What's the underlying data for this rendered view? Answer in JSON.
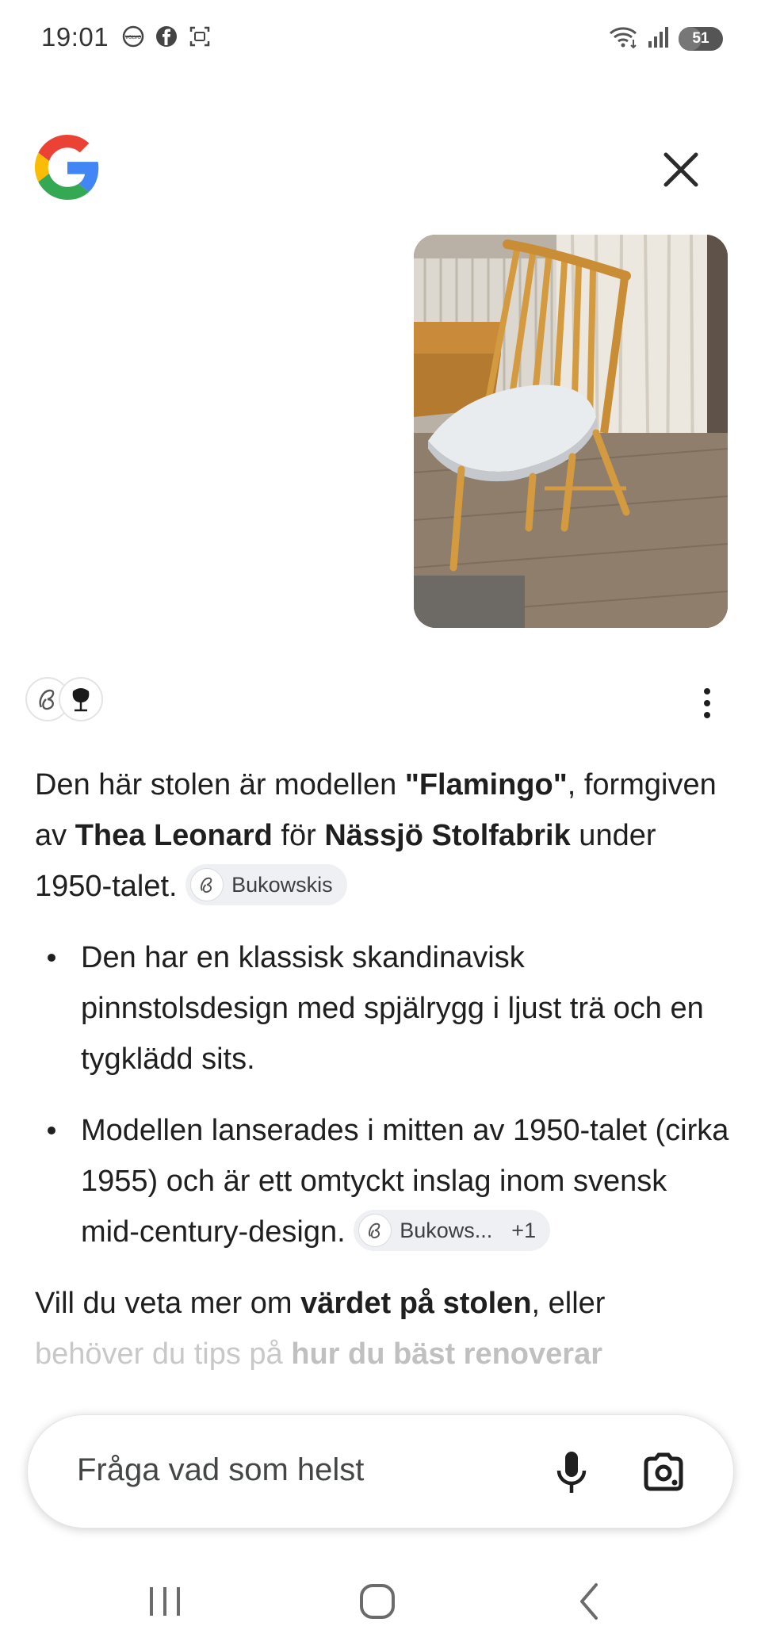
{
  "status_bar": {
    "time": "19:01",
    "battery": "51",
    "battery_level": 0.51,
    "left_icons": [
      "volvo-icon",
      "facebook-icon",
      "screenshot-icon"
    ],
    "right_icons": [
      "wifi-icon",
      "signal-icon",
      "battery-icon"
    ]
  },
  "header": {
    "logo": "google-logo-icon",
    "close_icon": "close-icon"
  },
  "uploaded_image": {
    "description_icon": "chair-photo"
  },
  "answer": {
    "intro": {
      "t1": "Den här stolen är modellen ",
      "b1": "\"Flamingo\"",
      "t2": ", formgiven av ",
      "b2": "Thea Leonard",
      "t3": " för ",
      "b3": "Nässjö Stolfabrik",
      "t4": " under 1950-talet. ",
      "chip": "Bukowskis"
    },
    "bullets": [
      {
        "text": "Den har en klassisk skandinavisk pinnstolsdesign med spjälrygg i ljust trä och en tygklädd sits."
      },
      {
        "text": "Modellen lanserades i mitten av 1950-talet (cirka 1955) och är ett omtyckt inslag inom svensk mid-century-design. ",
        "chip": "Bukows...",
        "chip_extra": "+1"
      }
    ],
    "outro": {
      "t1": "Vill du veta mer om ",
      "b1": "värdet på stolen",
      "t2": ", eller",
      "t3": "behöver du tips på ",
      "b2": "hur du bäst renoverar"
    }
  },
  "prompt": {
    "placeholder": "Fråga vad som helst",
    "mic_icon": "microphone-icon",
    "lens_icon": "google-lens-icon"
  },
  "nav": {
    "recents_icon": "recent-apps-icon",
    "home_icon": "home-icon",
    "back_icon": "back-icon"
  },
  "colors": {
    "text": "#1f1f1f",
    "chip_bg": "#eef0f4",
    "faded_text": "#c8c8c8",
    "google_blue": "#4285F4",
    "google_red": "#EA4335",
    "google_yellow": "#FBBC05",
    "google_green": "#34A853"
  }
}
